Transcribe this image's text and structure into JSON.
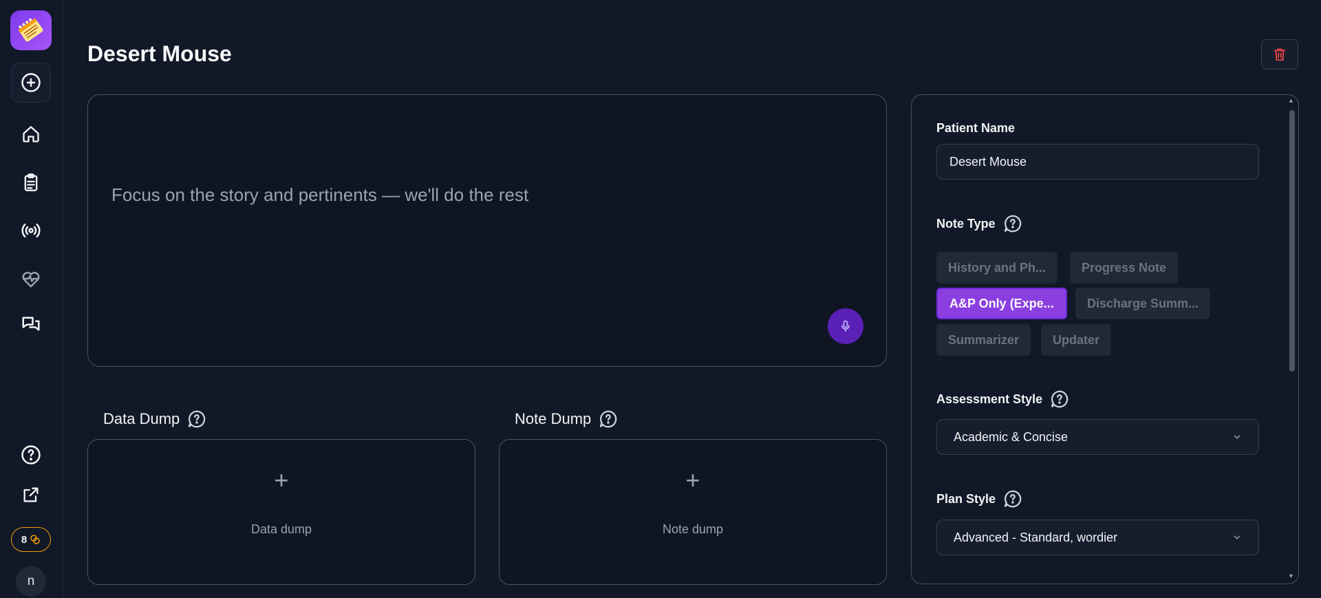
{
  "page": {
    "title": "Desert Mouse"
  },
  "story": {
    "placeholder": "Focus on the story and pertinents — we'll do the rest"
  },
  "dumps": {
    "data": {
      "heading": "Data Dump",
      "label": "Data dump",
      "plus": "+"
    },
    "note": {
      "heading": "Note Dump",
      "label": "Note dump",
      "plus": "+"
    }
  },
  "sidebar": {
    "credits": "8",
    "avatar_initial": "n",
    "items": [
      "plus-circle-icon",
      "home-icon",
      "clipboard-icon",
      "broadcast-icon",
      "heartbeat-icon",
      "chat-icon",
      "help-icon",
      "external-link-icon"
    ]
  },
  "panel": {
    "patient_name_label": "Patient Name",
    "patient_name_value": "Desert Mouse",
    "note_type_label": "Note Type",
    "note_types": [
      {
        "label": "History and Ph...",
        "active": false
      },
      {
        "label": "Progress Note",
        "active": false
      },
      {
        "label": "A&P Only (Expe...",
        "active": true
      },
      {
        "label": "Discharge Summ...",
        "active": false
      },
      {
        "label": "Summarizer",
        "active": false
      },
      {
        "label": "Updater",
        "active": false
      }
    ],
    "assessment_style_label": "Assessment Style",
    "assessment_style_value": "Academic & Concise",
    "plan_style_label": "Plan Style",
    "plan_style_value": "Advanced - Standard, wordier"
  },
  "colors": {
    "accent": "#8b3fe0",
    "background": "#111827",
    "credits_border": "#f59e0b",
    "delete_icon": "#ef4444"
  }
}
